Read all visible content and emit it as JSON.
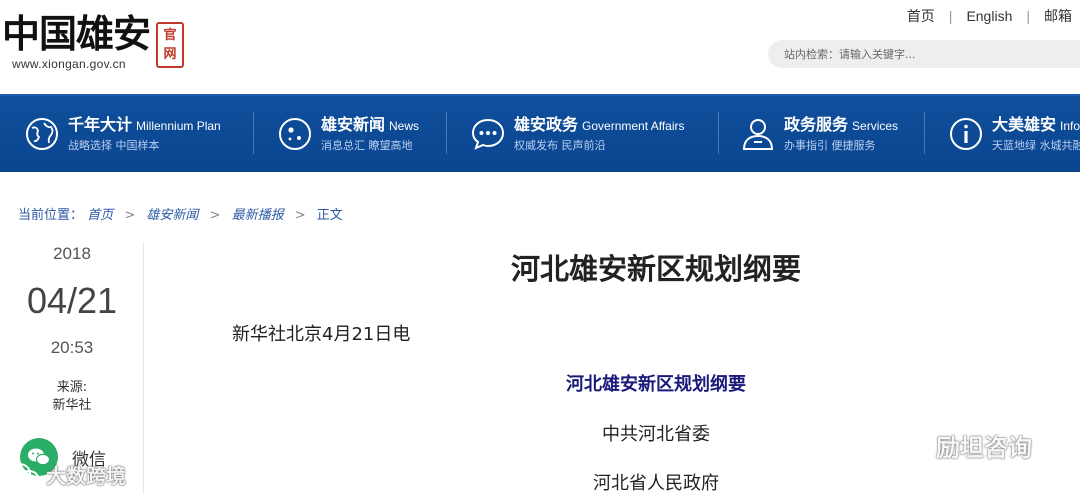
{
  "header": {
    "logo_title": "中国雄安",
    "logo_seal": "官网",
    "logo_url": "www.xiongan.gov.cn",
    "top_links": [
      "首页",
      "English",
      "邮箱"
    ],
    "search_placeholder": "站内检索：请输入关键字..."
  },
  "nav": {
    "items": [
      {
        "title": "千年大计",
        "en": "Millennium Plan",
        "sub": "战略选择 中国样本",
        "icon": "globe-icon"
      },
      {
        "title": "雄安新闻",
        "en": "News",
        "sub": "消息总汇 瞭望高地",
        "icon": "news-icon"
      },
      {
        "title": "雄安政务",
        "en": "Government Affairs",
        "sub": "权威发布 民声前沿",
        "icon": "chat-icon"
      },
      {
        "title": "政务服务",
        "en": "Services",
        "sub": "办事指引 便捷服务",
        "icon": "person-icon"
      },
      {
        "title": "大美雄安",
        "en": "Info",
        "sub": "天蓝地绿 水城共融",
        "icon": "info-icon"
      }
    ]
  },
  "breadcrumb": {
    "label": "当前位置：",
    "links": [
      "首页",
      "雄安新闻",
      "最新播报"
    ],
    "current": "正文",
    "separator": ">"
  },
  "meta": {
    "year": "2018",
    "date": "04/21",
    "time": "20:53",
    "source_label": "来源:",
    "source": "新华社",
    "share_wechat": "微信"
  },
  "article": {
    "title": "河北雄安新区规划纲要",
    "lead": "新华社北京4月21日电",
    "subtitle": "河北雄安新区规划纲要",
    "line1": "中共河北省委",
    "line2": "河北省人民政府"
  },
  "watermarks": {
    "left": "大数跨境",
    "right": "励坦咨询"
  },
  "colors": {
    "nav_bg": "#0b4590",
    "link": "#2d5aa6",
    "subtitle": "#1a1a7a",
    "seal": "#c0392b",
    "wechat": "#2aae67"
  }
}
